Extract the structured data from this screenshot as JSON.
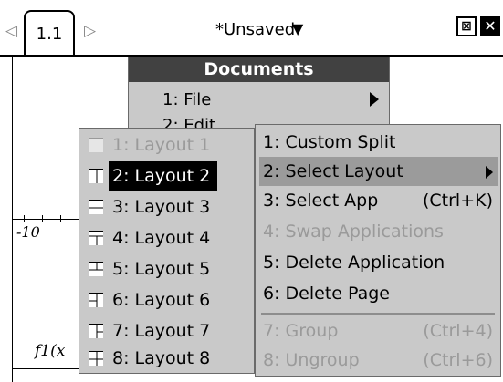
{
  "tabs": {
    "nav_prev": "◁",
    "current_label": "1.1",
    "nav_next": "▷"
  },
  "document": {
    "title": "*Unsaved",
    "dropdown_glyph": "▼"
  },
  "status": {
    "battery_glyph": "⊠",
    "close_glyph": "✕"
  },
  "graph": {
    "x_axis_label": "-10",
    "function_label": "f1(x"
  },
  "documents_menu": {
    "header": "Documents",
    "items": [
      {
        "label": "1: File"
      },
      {
        "label": "2: Edit"
      }
    ]
  },
  "layout_menu": {
    "items": [
      {
        "label": "1: Layout 1",
        "state": "disabled",
        "icon": "layout-1-icon"
      },
      {
        "label": "2: Layout 2",
        "state": "selected",
        "icon": "layout-2-icon"
      },
      {
        "label": "3: Layout 3",
        "state": "normal",
        "icon": "layout-3-icon"
      },
      {
        "label": "4: Layout 4",
        "state": "normal",
        "icon": "layout-4-icon"
      },
      {
        "label": "5: Layout 5",
        "state": "normal",
        "icon": "layout-5-icon"
      },
      {
        "label": "6: Layout 6",
        "state": "normal",
        "icon": "layout-6-icon"
      },
      {
        "label": "7: Layout 7",
        "state": "normal",
        "icon": "layout-7-icon"
      },
      {
        "label": "8: Layout 8",
        "state": "normal",
        "icon": "layout-8-icon"
      }
    ]
  },
  "actions_menu": {
    "items": [
      {
        "label": "1: Custom Split",
        "shortcut": "",
        "state": "normal"
      },
      {
        "label": "2: Select Layout",
        "shortcut": "",
        "state": "highlight"
      },
      {
        "label": "3: Select App",
        "shortcut": "(Ctrl+K)",
        "state": "normal"
      },
      {
        "label": "4: Swap Applications",
        "shortcut": "",
        "state": "disabled"
      },
      {
        "label": "5: Delete Application",
        "shortcut": "",
        "state": "normal"
      },
      {
        "label": "6: Delete Page",
        "shortcut": "",
        "state": "normal"
      },
      {
        "label": "7: Group",
        "shortcut": "(Ctrl+4)",
        "state": "disabled"
      },
      {
        "label": "8: Ungroup",
        "shortcut": "(Ctrl+6)",
        "state": "disabled"
      }
    ]
  },
  "colors": {
    "menu_bg": "#c9c9c9",
    "menu_header_bg": "#414141",
    "highlight_bg": "#9b9b9b",
    "selected_bg": "#000000",
    "disabled_text": "#9a9a9a"
  }
}
